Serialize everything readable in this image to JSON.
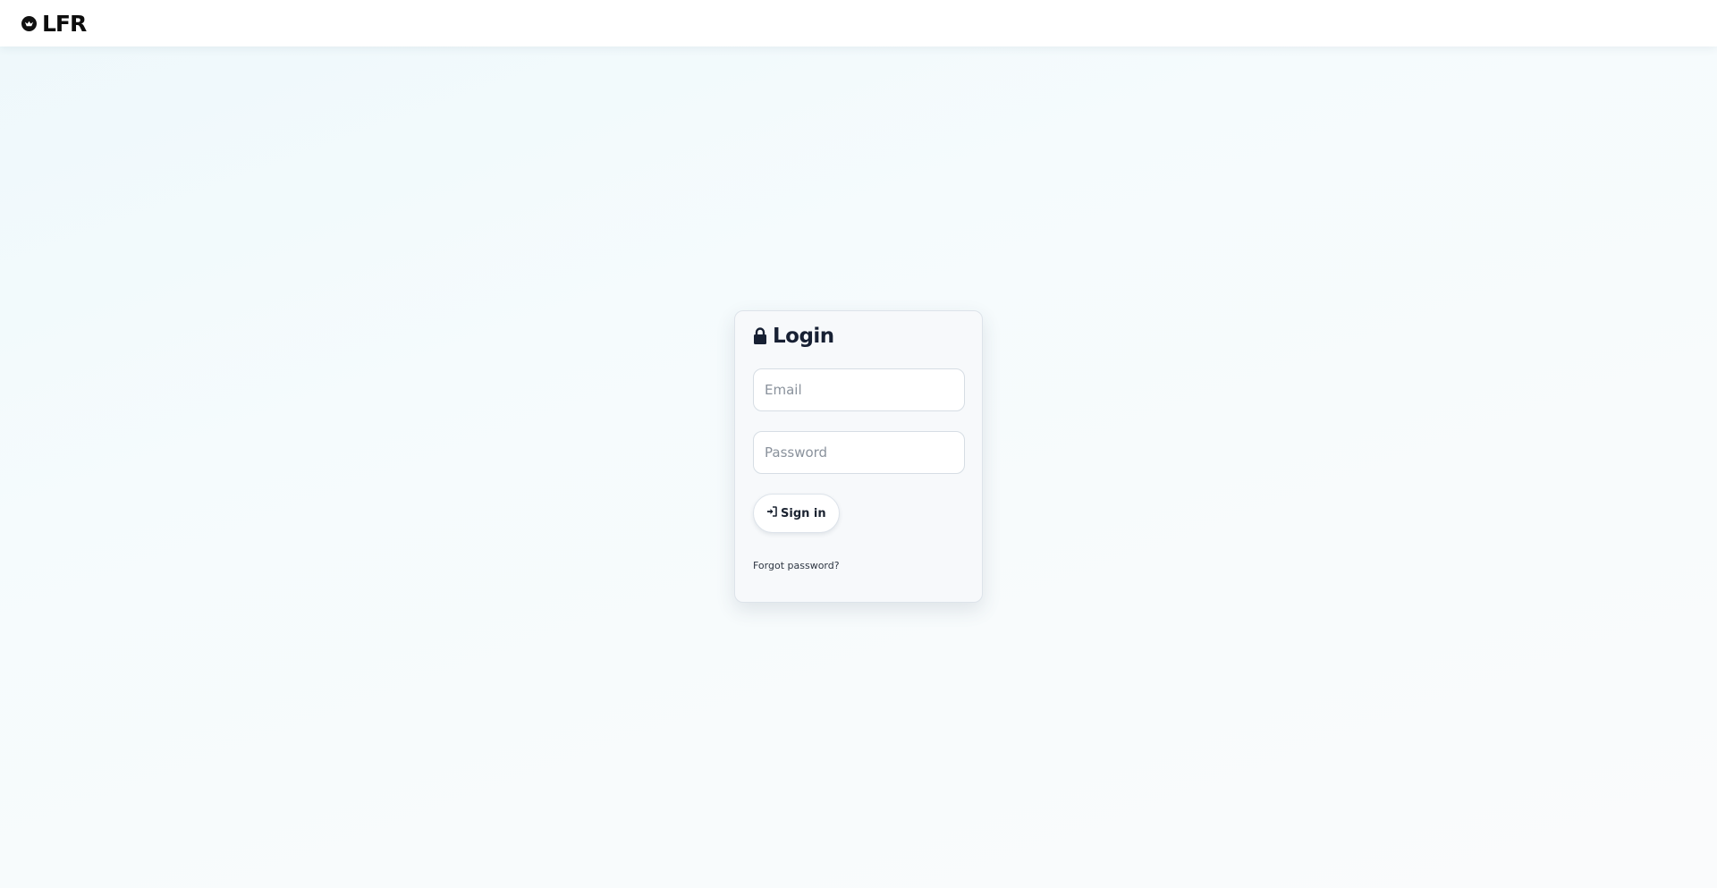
{
  "brand": {
    "name": "LFR",
    "logo_icon": "bird-badge-icon"
  },
  "login": {
    "title": "Login",
    "title_icon": "lock-icon",
    "email_placeholder": "Email",
    "password_placeholder": "Password",
    "signin_label": "Sign in",
    "signin_icon": "sign-in-icon",
    "forgot_label": "Forgot password?"
  },
  "colors": {
    "navbar_bg": "#ffffff",
    "card_bg": "#f7f9fb",
    "text_dark": "#172033",
    "page_bg": "#f5fbfd"
  }
}
